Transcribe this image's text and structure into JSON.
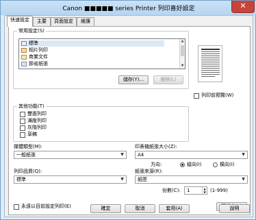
{
  "window": {
    "title": "Canon ■■■■■ series Printer 列印喜好設定",
    "close_glyph": "✕"
  },
  "tabs": [
    "快速設定",
    "主要",
    "頁面設定",
    "維護"
  ],
  "common_settings": {
    "label": "常用設定(S)",
    "items": [
      "標準",
      "相片列印",
      "商業文件",
      "節省紙張"
    ],
    "save_label": "儲存(Y)...",
    "delete_label": "刪除(L)"
  },
  "preview": {
    "checkbox_label": "列印前預覽(W)"
  },
  "other_features": {
    "label": "其他功能(T)",
    "items": [
      "雙面列印",
      "滿版列印",
      "灰階列印",
      "草稿"
    ]
  },
  "media_type": {
    "label": "媒體類型(M):",
    "value": "一般紙張"
  },
  "printer_paper_size": {
    "label": "印表機紙張大小(Z):",
    "value": "A4"
  },
  "orientation": {
    "label": "方向:",
    "portrait": "縱向(I)",
    "landscape": "橫向(I)",
    "selected": "portrait"
  },
  "print_quality": {
    "label": "列印品質(Q):",
    "value": "標準"
  },
  "paper_source": {
    "label": "紙張來源(R):",
    "value": "紙匣"
  },
  "copies": {
    "label": "份數(C):",
    "value": "1",
    "range": "(1-999)"
  },
  "always_print_current": {
    "label": "永遠以目前設定列印(E)"
  },
  "defaults_label": "預設值(F)",
  "buttons": {
    "ok": "確定",
    "cancel": "取消",
    "apply": "套用(A)",
    "help": "說明"
  }
}
